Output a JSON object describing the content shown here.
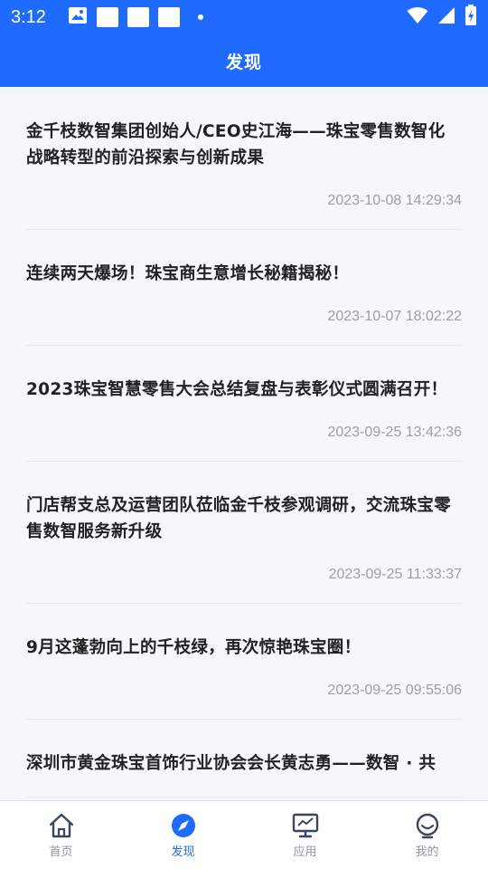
{
  "status_bar": {
    "time": "3:12"
  },
  "header": {
    "title": "发现"
  },
  "articles": [
    {
      "title": "金千枝数智集团创始人/CEO史江海——珠宝零售数智化战略转型的前沿探索与创新成果",
      "time": "2023-10-08 14:29:34"
    },
    {
      "title": "连续两天爆场！珠宝商生意增长秘籍揭秘！",
      "time": "2023-10-07 18:02:22"
    },
    {
      "title": "2023珠宝智慧零售大会总结复盘与表彰仪式圆满召开！",
      "time": "2023-09-25 13:42:36"
    },
    {
      "title": "门店帮支总及运营团队莅临金千枝参观调研，交流珠宝零售数智服务新升级",
      "time": "2023-09-25 11:33:37"
    },
    {
      "title": "9月这蓬勃向上的千枝绿，再次惊艳珠宝圈！",
      "time": "2023-09-25 09:55:06"
    },
    {
      "title": "深圳市黄金珠宝首饰行业协会会长黄志勇——数智 · 共",
      "time": ""
    }
  ],
  "tabs": [
    {
      "label": "首页",
      "icon": "home-icon",
      "active": false
    },
    {
      "label": "发现",
      "icon": "compass-icon",
      "active": true
    },
    {
      "label": "应用",
      "icon": "monitor-icon",
      "active": false
    },
    {
      "label": "我的",
      "icon": "profile-icon",
      "active": false
    }
  ],
  "colors": {
    "primary": "#1f6bff",
    "text": "#222222",
    "muted": "#9aa0aa",
    "tab_inactive": "#8e95a3"
  }
}
